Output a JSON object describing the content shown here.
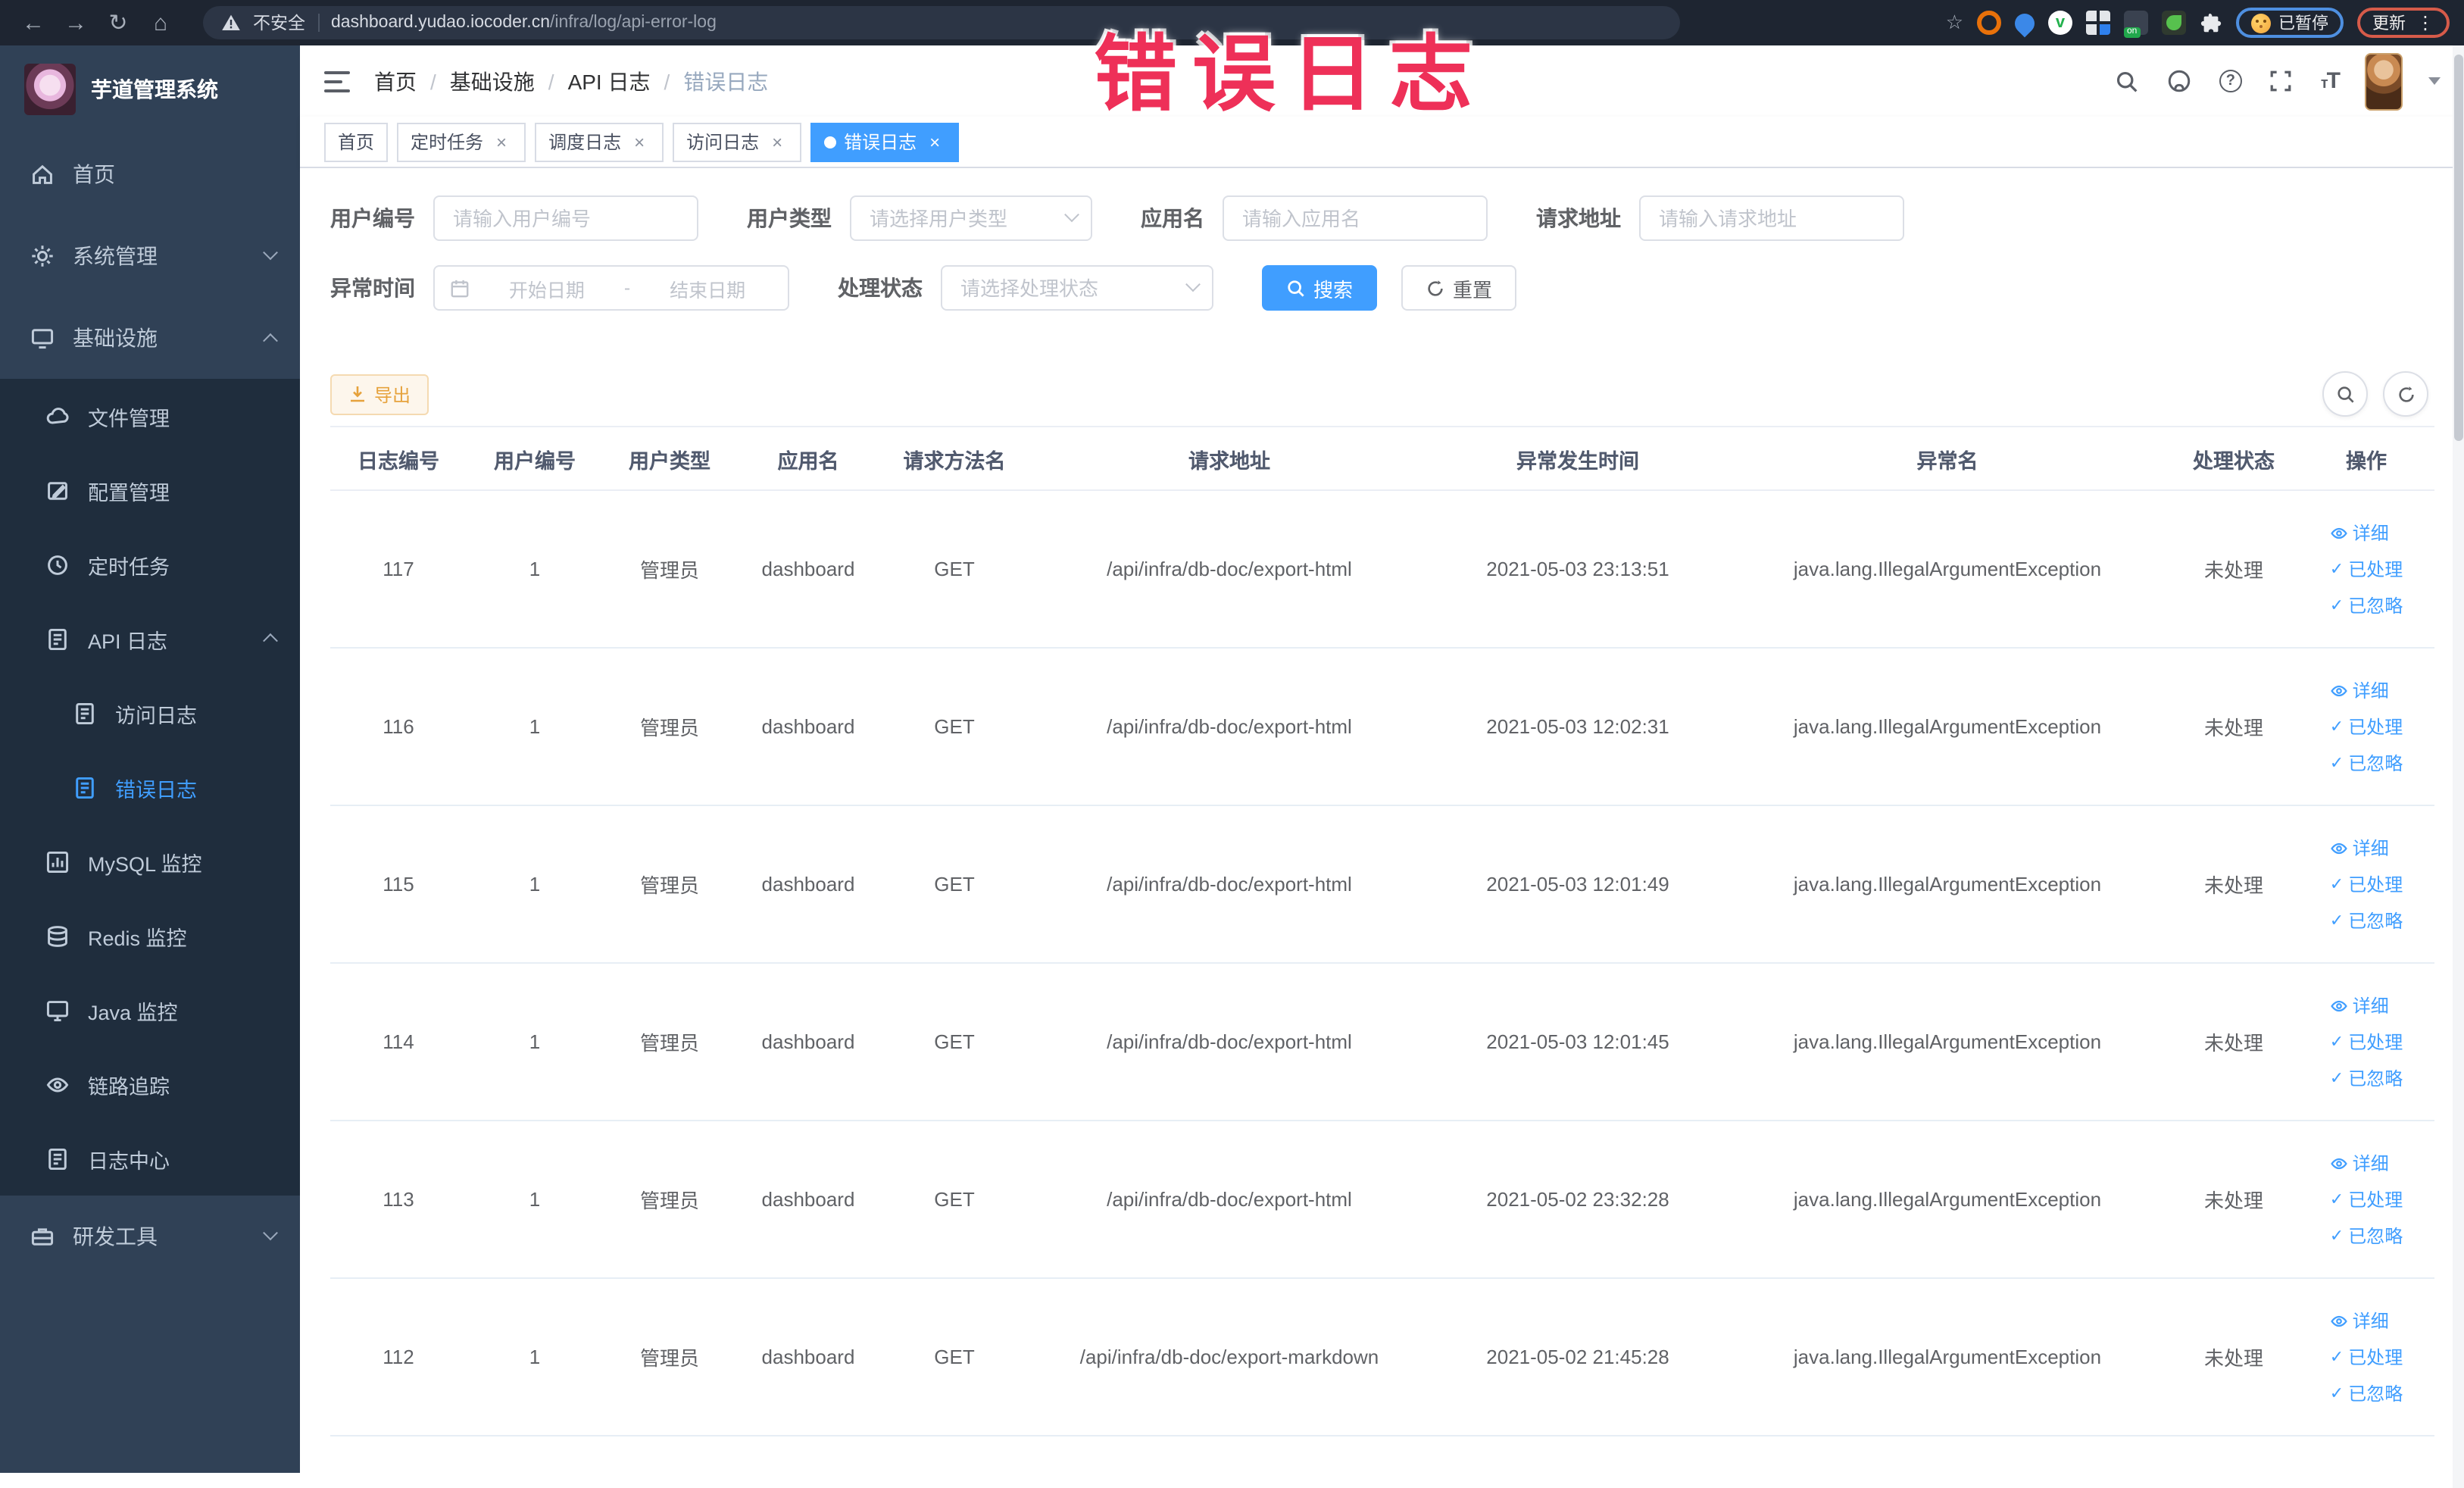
{
  "icons": {
    "back": "←",
    "forward": "→",
    "reload": "↻",
    "home": "⌂",
    "star": "☆",
    "kebab": "⋮",
    "close": "×",
    "check": "✓",
    "on_badge": "on"
  },
  "browser": {
    "security_label": "不安全",
    "url_domain": "dashboard.yudao.iocoder.cn",
    "url_path": "/infra/log/api-error-log",
    "paused_badge": "已暂停",
    "update_badge": "更新"
  },
  "annotation": {
    "text": "错误日志"
  },
  "sidebar": {
    "app_title": "芋道管理系统",
    "items": [
      {
        "label": "首页"
      },
      {
        "label": "系统管理"
      },
      {
        "label": "基础设施"
      },
      {
        "label": "文件管理"
      },
      {
        "label": "配置管理"
      },
      {
        "label": "定时任务"
      },
      {
        "label": "API 日志"
      },
      {
        "label": "访问日志"
      },
      {
        "label": "错误日志"
      },
      {
        "label": "MySQL 监控"
      },
      {
        "label": "Redis 监控"
      },
      {
        "label": "Java 监控"
      },
      {
        "label": "链路追踪"
      },
      {
        "label": "日志中心"
      },
      {
        "label": "研发工具"
      }
    ]
  },
  "breadcrumb": [
    "首页",
    "基础设施",
    "API 日志",
    "错误日志"
  ],
  "tabs": [
    {
      "label": "首页"
    },
    {
      "label": "定时任务"
    },
    {
      "label": "调度日志"
    },
    {
      "label": "访问日志"
    },
    {
      "label": "错误日志"
    }
  ],
  "filters": {
    "user_id": {
      "label": "用户编号",
      "placeholder": "请输入用户编号"
    },
    "user_type": {
      "label": "用户类型",
      "placeholder": "请选择用户类型"
    },
    "app_name": {
      "label": "应用名",
      "placeholder": "请输入应用名"
    },
    "request_url": {
      "label": "请求地址",
      "placeholder": "请输入请求地址"
    },
    "exception_time": {
      "label": "异常时间",
      "start_placeholder": "开始日期",
      "separator": "-",
      "end_placeholder": "结束日期"
    },
    "process_status": {
      "label": "处理状态",
      "placeholder": "请选择处理状态"
    },
    "search_label": "搜索",
    "reset_label": "重置"
  },
  "toolbar": {
    "export_label": "导出"
  },
  "table": {
    "columns": [
      "日志编号",
      "用户编号",
      "用户类型",
      "应用名",
      "请求方法名",
      "请求地址",
      "异常发生时间",
      "异常名",
      "处理状态",
      "操作"
    ],
    "actions": [
      "详细",
      "已处理",
      "已忽略"
    ],
    "rows": [
      {
        "id": "117",
        "user_id": "1",
        "user_type": "管理员",
        "app": "dashboard",
        "method": "GET",
        "url": "/api/infra/db-doc/export-html",
        "time": "2021-05-03 23:13:51",
        "exception": "java.lang.IllegalArgumentException",
        "status": "未处理"
      },
      {
        "id": "116",
        "user_id": "1",
        "user_type": "管理员",
        "app": "dashboard",
        "method": "GET",
        "url": "/api/infra/db-doc/export-html",
        "time": "2021-05-03 12:02:31",
        "exception": "java.lang.IllegalArgumentException",
        "status": "未处理"
      },
      {
        "id": "115",
        "user_id": "1",
        "user_type": "管理员",
        "app": "dashboard",
        "method": "GET",
        "url": "/api/infra/db-doc/export-html",
        "time": "2021-05-03 12:01:49",
        "exception": "java.lang.IllegalArgumentException",
        "status": "未处理"
      },
      {
        "id": "114",
        "user_id": "1",
        "user_type": "管理员",
        "app": "dashboard",
        "method": "GET",
        "url": "/api/infra/db-doc/export-html",
        "time": "2021-05-03 12:01:45",
        "exception": "java.lang.IllegalArgumentException",
        "status": "未处理"
      },
      {
        "id": "113",
        "user_id": "1",
        "user_type": "管理员",
        "app": "dashboard",
        "method": "GET",
        "url": "/api/infra/db-doc/export-html",
        "time": "2021-05-02 23:32:28",
        "exception": "java.lang.IllegalArgumentException",
        "status": "未处理"
      },
      {
        "id": "112",
        "user_id": "1",
        "user_type": "管理员",
        "app": "dashboard",
        "method": "GET",
        "url": "/api/infra/db-doc/export-markdown",
        "time": "2021-05-02 21:45:28",
        "exception": "java.lang.IllegalArgumentException",
        "status": "未处理"
      }
    ]
  }
}
